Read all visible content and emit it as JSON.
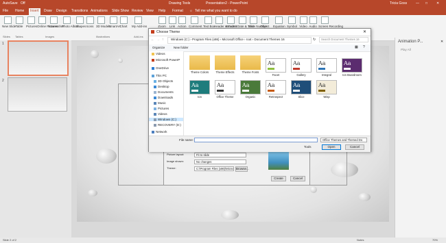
{
  "app": {
    "title": "Presentation2 - PowerPoint",
    "context_tab_group": "Drawing Tools",
    "user": "Tricia Goss",
    "autosave": "AutoSave",
    "autosave_state": "Off"
  },
  "tabs": [
    "File",
    "Home",
    "Insert",
    "Draw",
    "Design",
    "Transitions",
    "Animations",
    "Slide Show",
    "Review",
    "View",
    "Help",
    "Format"
  ],
  "active_tab": "Insert",
  "tell_me": "Tell me what you want to do",
  "ribbon": {
    "buttons": [
      "New Slide",
      "Table",
      "Pictures",
      "Online Pictures",
      "Screenshot",
      "Photo Album",
      "Shapes",
      "Icons",
      "3D Models",
      "SmartArt",
      "Chart",
      "My Add-ins",
      "Zoom",
      "Link",
      "Action",
      "Comment",
      "Text Box",
      "Header & Footer",
      "WordArt",
      "Date & Time",
      "Slide Number",
      "Object",
      "Equation",
      "Symbol",
      "Video",
      "Audio",
      "Screen Recording"
    ],
    "groups": [
      "Slides",
      "Tables",
      "Images",
      "Illustrations",
      "Add-ins",
      "Links",
      "Comments",
      "Text",
      "Symbols",
      "Media"
    ]
  },
  "slides": {
    "numbers": [
      "1",
      "2"
    ]
  },
  "anim_pane": {
    "title": "Animation P...",
    "play": "Play All"
  },
  "status": {
    "slide": "Slide 2 of 2",
    "notes": "Notes",
    "zoom": "70%"
  },
  "dialog": {
    "title": "Choose Theme",
    "address": [
      "Windows (C:)",
      "Program Files (x86)",
      "Microsoft Office",
      "root",
      "Document Themes 16"
    ],
    "search_placeholder": "Search Document Themes 16",
    "organize": "Organize",
    "new_folder": "New folder",
    "nav": [
      "Videos",
      "Microsoft PowerP",
      "OneDrive",
      "This PC",
      "3D Objects",
      "Desktop",
      "Documents",
      "Downloads",
      "Music",
      "Pictures",
      "Videos",
      "Windows (C:)",
      "RECOVERY (D:)",
      "Network"
    ],
    "files": [
      {
        "name": "Theme Colors",
        "kind": "folder"
      },
      {
        "name": "Theme Effects",
        "kind": "folder"
      },
      {
        "name": "Theme Fonts",
        "kind": "folder"
      },
      {
        "name": "Facet",
        "kind": "theme",
        "color": "#8fbf3f",
        "bg": "#ffffff"
      },
      {
        "name": "Gallery",
        "kind": "theme",
        "color": "#c0392b",
        "bg": "#ffffff"
      },
      {
        "name": "Integral",
        "kind": "theme",
        "color": "#2e75b6",
        "bg": "#ffffff"
      },
      {
        "name": "Ion Boardroom",
        "kind": "theme",
        "color": "#ffffff",
        "bg": "#5b2c6f"
      },
      {
        "name": "Ion",
        "kind": "theme",
        "color": "#ffffff",
        "bg": "#1e7c7c"
      },
      {
        "name": "Office Theme",
        "kind": "theme",
        "color": "#333333",
        "bg": "#ffffff"
      },
      {
        "name": "Organic",
        "kind": "theme",
        "color": "#ffffff",
        "bg": "#4a7a3a"
      },
      {
        "name": "Retrospect",
        "kind": "theme",
        "color": "#c55a11",
        "bg": "#ffffff"
      },
      {
        "name": "Slice",
        "kind": "theme",
        "color": "#ffffff",
        "bg": "#1f4e79"
      },
      {
        "name": "Wisp",
        "kind": "theme",
        "color": "#7f6000",
        "bg": "#f3ecd9"
      }
    ],
    "file_name_label": "File name:",
    "file_name_value": "",
    "file_type": "Office Themes and Themed Do",
    "tools": "Tools",
    "open": "Open",
    "cancel": "Cancel"
  },
  "under_panel": {
    "fields": [
      {
        "label": "Picture layout:",
        "value": "Fit to slide"
      },
      {
        "label": "Image shown:",
        "value": "No changes"
      },
      {
        "label": "Theme:",
        "value": "C:\\Program Files (x86)\\Microsoft Off"
      }
    ],
    "browse": "Browse...",
    "create": "Create",
    "cancel": "Cancel"
  }
}
